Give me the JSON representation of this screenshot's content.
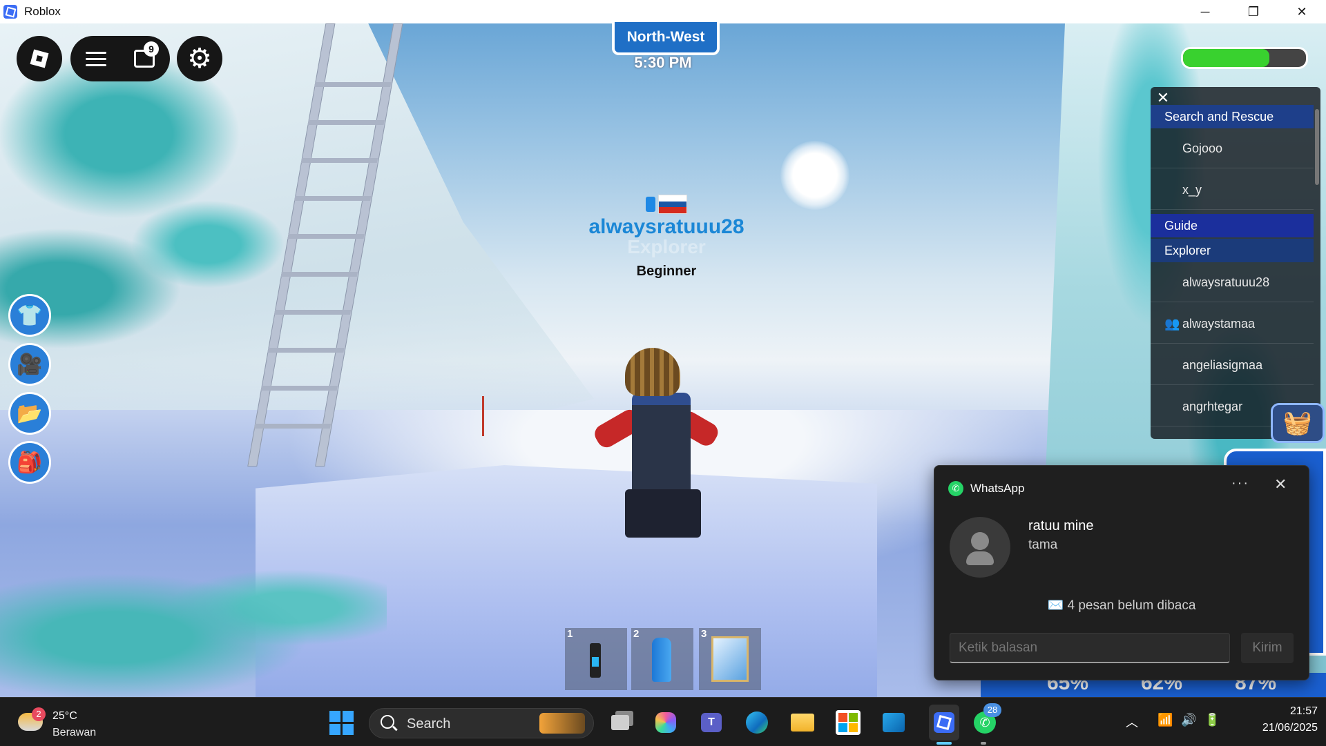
{
  "window": {
    "title": "Roblox",
    "minimize_glyph": "─",
    "restore_glyph": "❐",
    "close_glyph": "✕"
  },
  "hud": {
    "compass": "North-West",
    "time": "5:30 PM",
    "chat_badge": "9",
    "stamina_level": 0.7
  },
  "nametag": {
    "player_name": "alwaysratuuu28",
    "faint_role": "Explorer",
    "rank": "Beginner",
    "flag": "russia"
  },
  "player_list": {
    "close_glyph": "✕",
    "teams": [
      {
        "name": "Search and Rescue",
        "players": [
          "Gojooo",
          "x_y"
        ]
      },
      {
        "name": "Guide",
        "players": []
      },
      {
        "name": "Explorer",
        "players": [
          "alwaysratuuu28",
          "alwaystamaa",
          "angeliasigmaa",
          "angrhtegar"
        ]
      }
    ]
  },
  "hotbar": [
    {
      "slot": "1",
      "item": "radio"
    },
    {
      "slot": "2",
      "item": "water-bottle"
    },
    {
      "slot": "3",
      "item": "map"
    }
  ],
  "side_buttons": [
    "outfit-icon",
    "camera-icon",
    "folder-icon",
    "backpack-icon"
  ],
  "right_stats": [
    "65%",
    "62%",
    "87%"
  ],
  "whatsapp": {
    "app_name": "WhatsApp",
    "more_glyph": "···",
    "close_glyph": "✕",
    "sender": "ratuu mine",
    "message": "tama",
    "unread": "✉️ 4 pesan belum dibaca",
    "reply_placeholder": "Ketik balasan",
    "send_label": "Kirim"
  },
  "taskbar": {
    "weather_temp": "25°C",
    "weather_condition": "Berawan",
    "weather_badge": "2",
    "search_label": "Search",
    "whatsapp_badge": "28",
    "time": "21:57",
    "date": "21/06/2025",
    "tray_up_glyph": "︿"
  },
  "colors": {
    "compass_bg": "#1f6fc6",
    "player_name": "#1b87d6",
    "stamina": "#39d12f",
    "team_header": "#1e3f8a",
    "taskbar_bg": "#1c1c1c"
  }
}
